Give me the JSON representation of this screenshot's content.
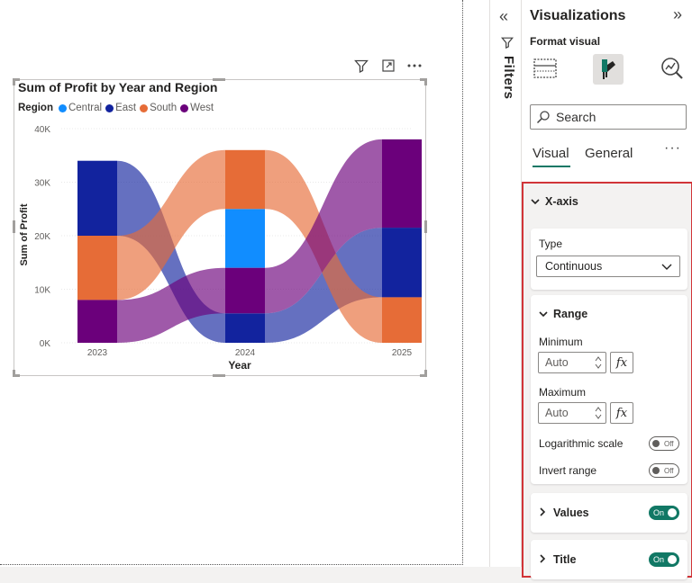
{
  "canvas": {
    "header_icons": [
      "filter-icon",
      "focus-mode-icon",
      "more-options-icon"
    ]
  },
  "visual": {
    "title": "Sum of Profit by Year and Region"
  },
  "chart_data": {
    "type": "bar",
    "subtype": "ribbon",
    "title": "Sum of Profit by Year and Region",
    "xlabel": "Year",
    "ylabel": "Sum of Profit",
    "categories": [
      "2023",
      "2024",
      "2025"
    ],
    "yticks": [
      "0K",
      "10K",
      "20K",
      "30K",
      "40K"
    ],
    "ylim": [
      0,
      40000
    ],
    "legend": {
      "title": "Region",
      "position": "top-left"
    },
    "series": [
      {
        "name": "Central",
        "color": "#118DFF",
        "values": [
          0,
          11000,
          0
        ]
      },
      {
        "name": "East",
        "color": "#12239E",
        "values": [
          14000,
          5500,
          13000
        ]
      },
      {
        "name": "South",
        "color": "#E66C37",
        "values": [
          12000,
          11000,
          8500
        ]
      },
      {
        "name": "West",
        "color": "#6B007B",
        "values": [
          8000,
          8500,
          16500
        ]
      }
    ]
  },
  "filters": {
    "label": "Filters"
  },
  "viz_pane": {
    "title": "Visualizations",
    "subtitle": "Format visual",
    "search_placeholder": "Search",
    "tabs": {
      "visual": "Visual",
      "general": "General"
    },
    "x_axis": {
      "header": "X-axis",
      "type_label": "Type",
      "type_value": "Continuous",
      "range_header": "Range",
      "minimum_label": "Minimum",
      "minimum_value": "Auto",
      "maximum_label": "Maximum",
      "maximum_value": "Auto",
      "fx_label": "fx",
      "log_scale_label": "Logarithmic scale",
      "log_scale_state": "Off",
      "invert_label": "Invert range",
      "invert_state": "Off"
    },
    "values_section": {
      "label": "Values",
      "state": "On"
    },
    "title_section": {
      "label": "Title",
      "state": "On"
    }
  },
  "colors": {
    "accent": "#117865",
    "highlight_border": "#d13438"
  }
}
